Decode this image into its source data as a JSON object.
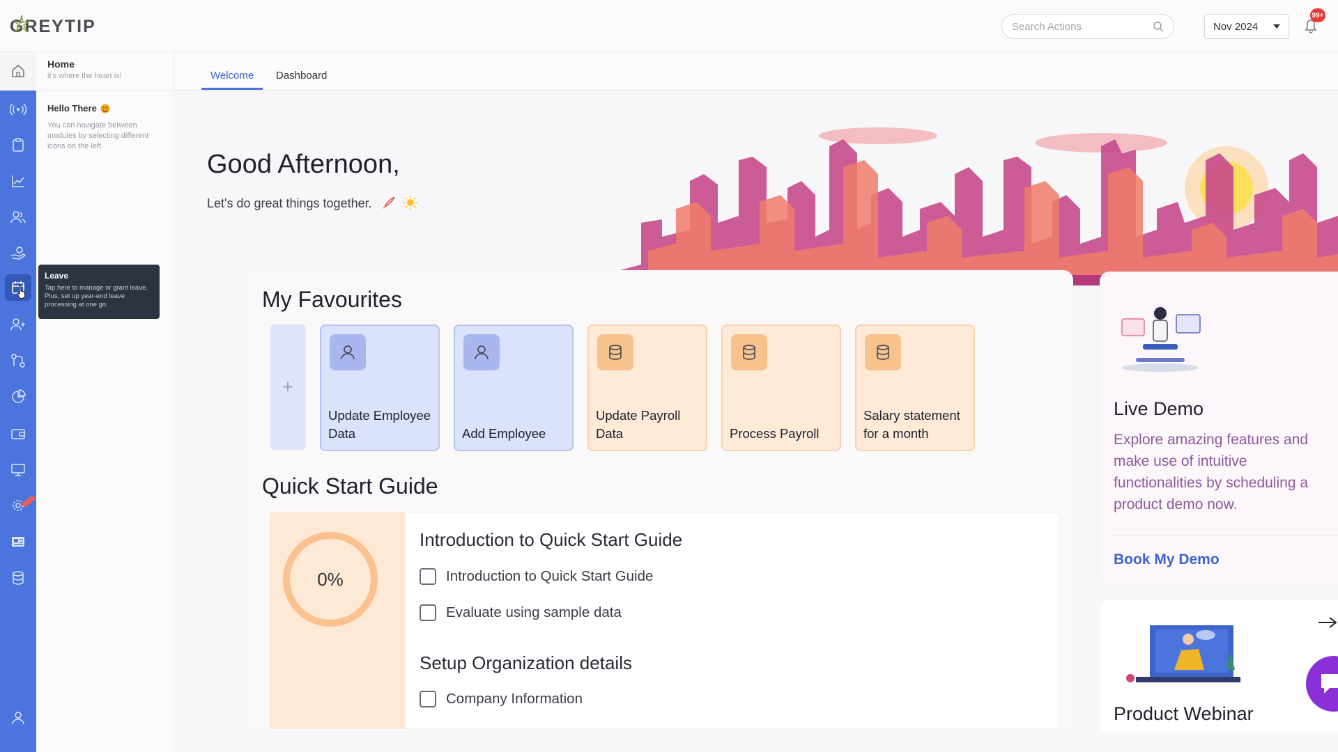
{
  "app": {
    "logo_text": "GREYTIP"
  },
  "topbar": {
    "search_placeholder": "Search Actions",
    "month_selector": "Nov 2024",
    "notification_badge": "99+"
  },
  "sidepanel": {
    "home_title": "Home",
    "home_subtitle": "it's where the heart is!",
    "hello_title": "Hello There",
    "hello_text": "You can navigate between modules by selecting different icons on the left"
  },
  "tooltip": {
    "title": "Leave",
    "text": "Tap here to manage or grant leave. Plus, set up year-end leave processing at one go."
  },
  "tabs": [
    "Welcome",
    "Dashboard"
  ],
  "greeting": {
    "title": "Good Afternoon,",
    "subtitle": "Let's do great things together."
  },
  "favourites": {
    "title": "My Favourites",
    "add_symbol": "+",
    "items": [
      {
        "label": "Update Employee Data",
        "icon": "user-icon",
        "color": "blue"
      },
      {
        "label": "Add Employee",
        "icon": "user-icon",
        "color": "blue"
      },
      {
        "label": "Update Payroll Data",
        "icon": "database-icon",
        "color": "peach"
      },
      {
        "label": "Process Payroll",
        "icon": "database-icon",
        "color": "peach"
      },
      {
        "label": "Salary statement for a month",
        "icon": "database-icon",
        "color": "peach"
      }
    ]
  },
  "quick_start": {
    "title": "Quick Start Guide",
    "progress": "0%",
    "sections": [
      {
        "heading": "Introduction to Quick Start Guide",
        "items": [
          "Introduction to Quick Start Guide",
          "Evaluate using sample data"
        ]
      },
      {
        "heading": "Setup Organization details",
        "items": [
          "Company Information"
        ]
      }
    ]
  },
  "live_demo": {
    "title": "Live Demo",
    "description": "Explore amazing features and make use of intuitive functionalities by scheduling a product demo now.",
    "link": "Book My Demo"
  },
  "webinar": {
    "title": "Product Webinar"
  },
  "colors": {
    "rail": "#4b74dc",
    "accent": "#3f64c9",
    "fav_blue": "#dbe2fb",
    "fav_peach": "#fdebd8",
    "demo_text": "#8a5a9e"
  }
}
